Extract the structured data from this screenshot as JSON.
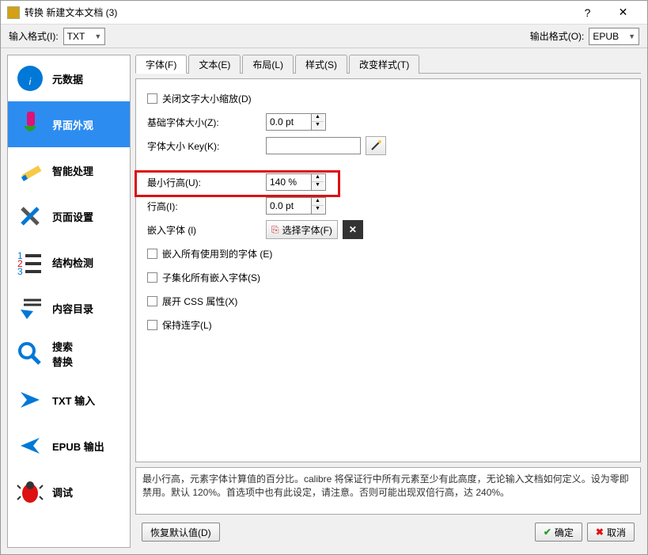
{
  "window": {
    "title": "转换 新建文本文档 (3)"
  },
  "format": {
    "input_label": "输入格式(I):",
    "input_value": "TXT",
    "output_label": "输出格式(O):",
    "output_value": "EPUB"
  },
  "sidebar": {
    "items": [
      {
        "label": "元数据"
      },
      {
        "label": "界面外观"
      },
      {
        "label": "智能处理"
      },
      {
        "label": "页面设置"
      },
      {
        "label": "结构检测"
      },
      {
        "label": "内容目录"
      },
      {
        "label": "搜索\n替换"
      },
      {
        "label": "TXT 输入"
      },
      {
        "label": "EPUB 输出"
      },
      {
        "label": "调试"
      }
    ]
  },
  "tabs": [
    {
      "label": "字体(F)"
    },
    {
      "label": "文本(E)"
    },
    {
      "label": "布局(L)"
    },
    {
      "label": "样式(S)"
    },
    {
      "label": "改变样式(T)"
    }
  ],
  "form": {
    "disable_rescale": "关闭文字大小缩放(D)",
    "base_font_label": "基础字体大小(Z):",
    "base_font_value": "0.0 pt",
    "font_key_label": "字体大小 Key(K):",
    "font_key_value": "",
    "min_line_label": "最小行高(U):",
    "min_line_value": "140 %",
    "line_height_label": "行高(I):",
    "line_height_value": "0.0 pt",
    "embed_font_label": "嵌入字体 (l)",
    "select_font_btn": "选择字体(F)",
    "embed_all": "嵌入所有使用到的字体 (E)",
    "subset_all": "子集化所有嵌入字体(S)",
    "expand_css": "展开 CSS 属性(X)",
    "keep_ligatures": "保持连字(L)"
  },
  "help": {
    "text": "最小行高，元素字体计算值的百分比。calibre 将保证行中所有元素至少有此高度，无论输入文档如何定义。设为零即禁用。默认 120%。首选项中也有此设定，请注意。否则可能出现双倍行高，达 240%。"
  },
  "buttons": {
    "restore": "恢复默认值(D)",
    "ok": "确定",
    "cancel": "取消"
  }
}
